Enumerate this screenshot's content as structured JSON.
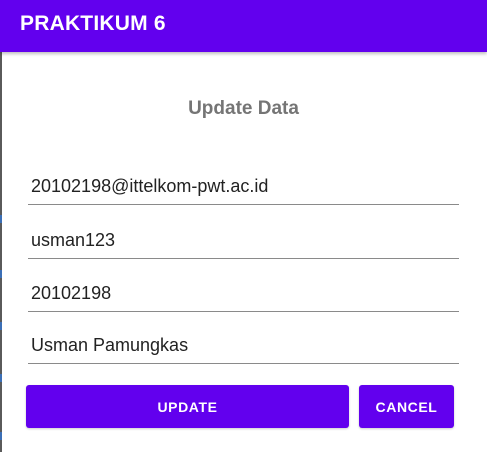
{
  "app_bar": {
    "title": "PRAKTIKUM 6",
    "color": "#6200ee"
  },
  "dialog": {
    "title": "Update Data",
    "fields": [
      {
        "value": "20102198@ittelkom-pwt.ac.id"
      },
      {
        "value": "usman123"
      },
      {
        "value": "20102198"
      },
      {
        "value": "Usman Pamungkas"
      }
    ],
    "buttons": {
      "update_label": "UPDATE",
      "cancel_label": "CANCEL"
    }
  }
}
